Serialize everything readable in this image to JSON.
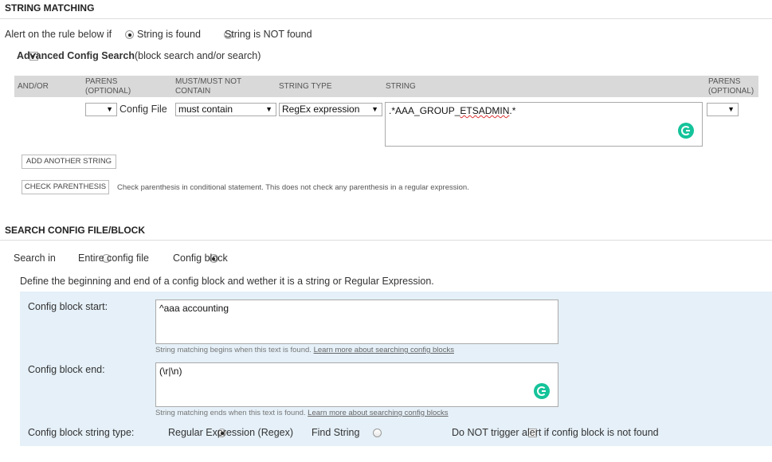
{
  "string_matching": {
    "title": "STRING MATCHING",
    "alert_label": "Alert on the rule below if",
    "opt_found": "String is found",
    "opt_not_found": "String is NOT found",
    "advanced_label": "Advanced Config Search",
    "advanced_hint": "(block search and/or search)",
    "table": {
      "headers": {
        "andor": "AND/OR",
        "parens_open": "PARENS (OPTIONAL)",
        "must": "MUST/MUST NOT CONTAIN",
        "type": "STRING TYPE",
        "string": "STRING",
        "parens_close": "PARENS (OPTIONAL)"
      },
      "row": {
        "paren_open_value": "",
        "source": "Config File",
        "must_value": "must contain",
        "type_value": "RegEx expression",
        "string_prefix": ".*AAA_GROUP_",
        "string_flagged": "ETSADMIN",
        "string_suffix": ".*",
        "paren_close_value": ""
      }
    },
    "add_button": "ADD ANOTHER STRING",
    "check_button": "CHECK PARENTHESIS",
    "check_hint": "Check parenthesis in conditional statement. This does not check any parenthesis in a regular expression."
  },
  "search_block": {
    "title": "SEARCH CONFIG FILE/BLOCK",
    "search_in_label": "Search in",
    "opt_entire": "Entire config file",
    "opt_block": "Config block",
    "define_text": "Define the beginning and end of a config block and wether it is a string or Regular Expression.",
    "start_label": "Config block start:",
    "start_value": "^aaa accounting",
    "start_hint": "String matching begins when this text is found.",
    "end_label": "Config block end:",
    "end_value": "(\\r|\\n)",
    "end_hint": "String matching ends when this text is found.",
    "learn_more": "Learn more about searching config blocks",
    "type_label": "Config block string type:",
    "opt_regex": "Regular Expression (Regex)",
    "opt_find": "Find String",
    "no_trigger_label": "Do NOT trigger alert if config block is not found"
  }
}
